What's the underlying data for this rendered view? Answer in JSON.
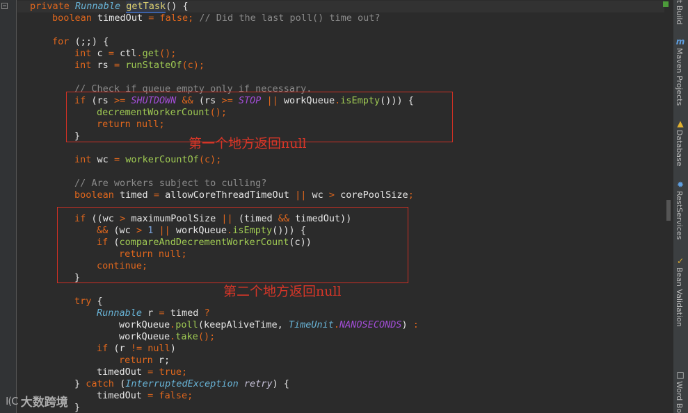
{
  "editor": {
    "lines": [
      [
        "private",
        "Runnable",
        "getTask",
        "() {"
      ],
      [
        "boolean",
        "timedOut",
        "=",
        "false",
        ";",
        "// Did the last poll() time out?"
      ],
      [],
      [
        "for",
        "(;;) {"
      ],
      [
        "int",
        "c",
        "=",
        "ctl",
        ".",
        "get",
        "();"
      ],
      [
        "int",
        "rs",
        "=",
        "runStateOf",
        "(c);"
      ],
      [],
      [
        "// Check if queue empty only if necessary."
      ],
      [
        "if",
        "(rs",
        ">=",
        "SHUTDOWN",
        "&&",
        "(rs",
        ">=",
        "STOP",
        "||",
        "workQueue",
        ".",
        "isEmpty",
        "())) {"
      ],
      [
        "decrementWorkerCount",
        "();"
      ],
      [
        "return",
        "null",
        ";"
      ],
      [
        "}"
      ],
      [],
      [
        "int",
        "wc",
        "=",
        "workerCountOf",
        "(c);"
      ],
      [],
      [
        "// Are workers subject to culling?"
      ],
      [
        "boolean",
        "timed",
        "=",
        "allowCoreThreadTimeOut",
        "||",
        "wc",
        ">",
        "corePoolSize",
        ";"
      ],
      [],
      [
        "if",
        "((wc",
        ">",
        "maximumPoolSize",
        "||",
        "(timed",
        "&&",
        "timedOut))"
      ],
      [
        "&&",
        "(wc",
        ">",
        "1",
        "||",
        "workQueue",
        ".",
        "isEmpty",
        "())) {"
      ],
      [
        "if",
        "(",
        "compareAndDecrementWorkerCount",
        "(c))"
      ],
      [
        "return",
        "null",
        ";"
      ],
      [
        "continue",
        ";"
      ],
      [
        "}"
      ],
      [],
      [
        "try",
        "{"
      ],
      [
        "Runnable",
        "r",
        "=",
        "timed",
        "?"
      ],
      [
        "workQueue",
        ".",
        "poll",
        "(keepAliveTime,",
        "TimeUnit",
        ".",
        "NANOSECONDS",
        ")",
        ":"
      ],
      [
        "workQueue",
        ".",
        "take",
        "();"
      ],
      [
        "if",
        "(r",
        "!=",
        "null",
        ")"
      ],
      [
        "return",
        "r;"
      ],
      [
        "timedOut",
        "=",
        "true",
        ";"
      ],
      [
        "}",
        "catch",
        "(",
        "InterruptedException",
        "retry",
        ") {"
      ],
      [
        "timedOut",
        "=",
        "false",
        ";"
      ],
      [
        "}"
      ]
    ]
  },
  "annotations": {
    "first": "第一个地方返回null",
    "second": "第二个地方返回null"
  },
  "right_panel": {
    "tools": [
      {
        "label": "t Build",
        "icon": ""
      },
      {
        "label": "Maven Projects",
        "icon": "maven-icon"
      },
      {
        "label": "Database",
        "icon": "database-icon"
      },
      {
        "label": "RestServices",
        "icon": "rest-services-icon"
      },
      {
        "label": "Bean Validation",
        "icon": "bean-validation-icon"
      },
      {
        "label": "Word Bo",
        "icon": "word-book-icon"
      }
    ]
  },
  "watermark": {
    "logo": "I(C",
    "text": "大数跨境"
  },
  "colors": {
    "background": "#2b2b2b",
    "keyword": "#e0671d",
    "type": "#68b3d6",
    "comment": "#8a8a8a",
    "method_decl": "#ddd070",
    "method_call": "#9fca53",
    "constant": "#a24dd6",
    "number": "#7aa1d9",
    "annotation_red": "#d63628"
  }
}
